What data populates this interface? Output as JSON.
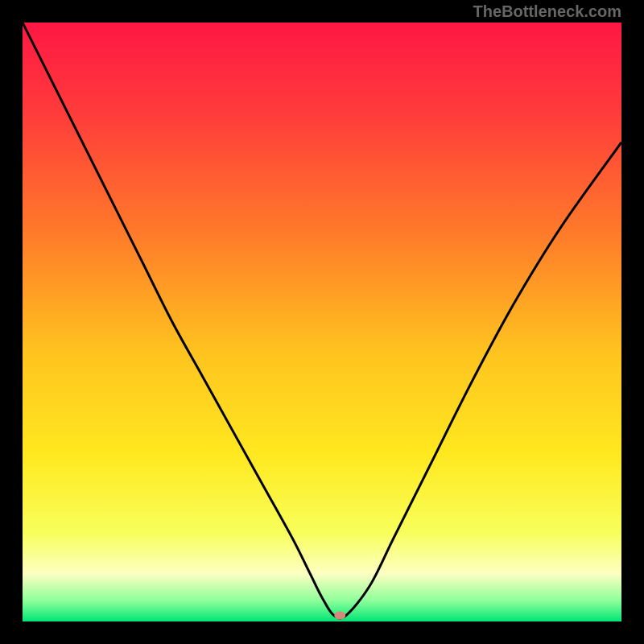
{
  "watermark": "TheBottleneck.com",
  "chart_data": {
    "type": "line",
    "title": "",
    "xlabel": "",
    "ylabel": "",
    "xlim": [
      0,
      100
    ],
    "ylim": [
      0,
      100
    ],
    "background_gradient": {
      "type": "vertical",
      "stops": [
        {
          "pos": 0.0,
          "color": "#ff1744"
        },
        {
          "pos": 0.15,
          "color": "#ff3b3b"
        },
        {
          "pos": 0.35,
          "color": "#ff7a2a"
        },
        {
          "pos": 0.55,
          "color": "#ffc31f"
        },
        {
          "pos": 0.72,
          "color": "#ffe81f"
        },
        {
          "pos": 0.85,
          "color": "#f8ff5a"
        },
        {
          "pos": 0.92,
          "color": "#fdffc2"
        },
        {
          "pos": 0.965,
          "color": "#8fff9a"
        },
        {
          "pos": 1.0,
          "color": "#00e676"
        }
      ]
    },
    "series": [
      {
        "name": "bottleneck-curve",
        "color": "#000000",
        "x": [
          0,
          5,
          10,
          15,
          20,
          25,
          30,
          35,
          40,
          45,
          48,
          50,
          52,
          54,
          58,
          62,
          68,
          75,
          82,
          90,
          100
        ],
        "values": [
          100,
          90,
          80,
          70,
          60,
          50,
          41,
          32,
          23,
          14,
          8,
          4,
          1,
          1,
          6,
          14,
          26,
          40,
          53,
          66,
          80
        ]
      }
    ],
    "marker": {
      "name": "optimal-point",
      "x": 53,
      "y": 1,
      "color": "#d48a7a",
      "rx": 7,
      "ry": 5
    }
  }
}
